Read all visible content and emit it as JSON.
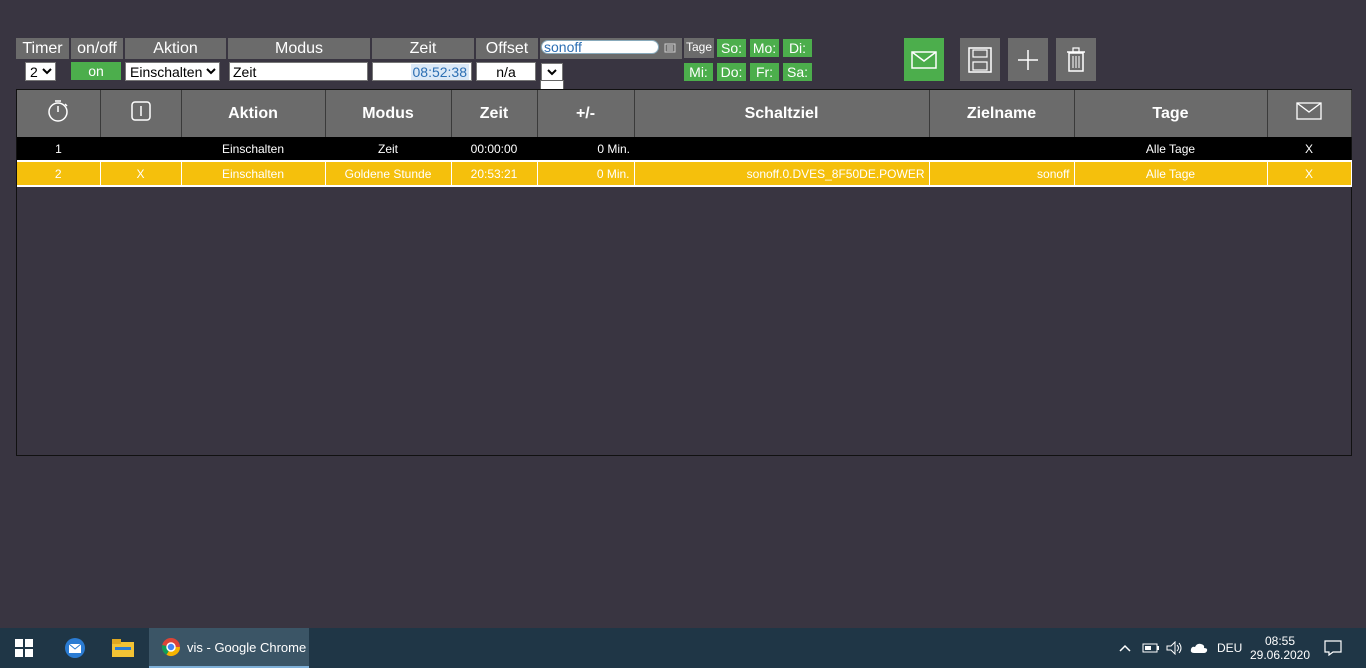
{
  "header": {
    "timer": "Timer",
    "onoff": "on/off",
    "aktion": "Aktion",
    "modus": "Modus",
    "zeit": "Zeit",
    "offset": "Offset",
    "search_value": "sonoff",
    "tage": "Tage"
  },
  "controls": {
    "timer_select": "2",
    "onoff_value": "on",
    "aktion_select": "Einschalten",
    "modus_value": "Zeit",
    "zeit_value": "08:52:38",
    "offset_value": "n/a"
  },
  "days": {
    "so": "So:",
    "mo": "Mo:",
    "di": "Di:",
    "mi": "Mi:",
    "do": "Do:",
    "fr": "Fr:",
    "sa": "Sa:"
  },
  "table": {
    "headers": [
      "",
      "",
      "Aktion",
      "Modus",
      "Zeit",
      "+/-",
      "Schaltziel",
      "Zielname",
      "Tage",
      ""
    ],
    "rows": [
      [
        "1",
        "",
        "Einschalten",
        "Zeit",
        "00:00:00",
        "0 Min.",
        "",
        "",
        "Alle Tage",
        "X"
      ],
      [
        "2",
        "X",
        "Einschalten",
        "Goldene Stunde",
        "20:53:21",
        "0 Min.",
        "sonoff.0.DVES_8F50DE.POWER",
        "sonoff",
        "Alle Tage",
        "X"
      ]
    ]
  },
  "taskbar": {
    "chrome_label": "vis - Google Chrome",
    "lang": "DEU",
    "time": "08:55",
    "date": "29.06.2020"
  },
  "colors": {
    "background": "#393541",
    "header_gray": "#6b6b6b",
    "green": "#4cae4c",
    "highlight_row": "#f5c00c",
    "taskbar": "#1f3646"
  }
}
